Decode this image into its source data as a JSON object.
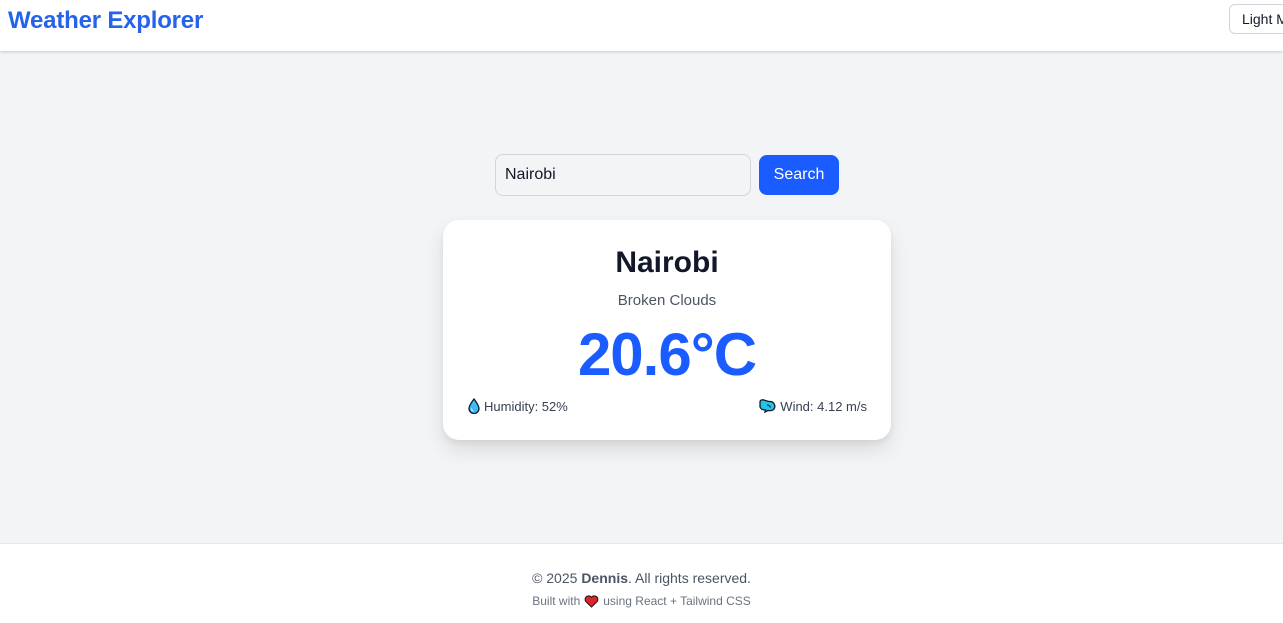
{
  "header": {
    "brand": "Weather Explorer",
    "theme_toggle_label": "Light Mode"
  },
  "search": {
    "value": "Nairobi",
    "button_label": "Search"
  },
  "weather": {
    "city": "Nairobi",
    "description": "Broken Clouds",
    "temperature": "20.6°C",
    "humidity": "Humidity: 52%",
    "wind": "Wind: 4.12 m/s"
  },
  "footer": {
    "copyright_prefix": "© 2025",
    "author": "Dennis",
    "copyright_suffix": ". All rights reserved.",
    "built_prefix": "Built with",
    "built_suffix": "using React + Tailwind CSS"
  },
  "icons": {
    "humidity": "droplet-icon",
    "wind": "wind-icon",
    "heart": "heart-icon"
  },
  "colors": {
    "accent": "#1a5cff",
    "brand": "#2563eb"
  }
}
